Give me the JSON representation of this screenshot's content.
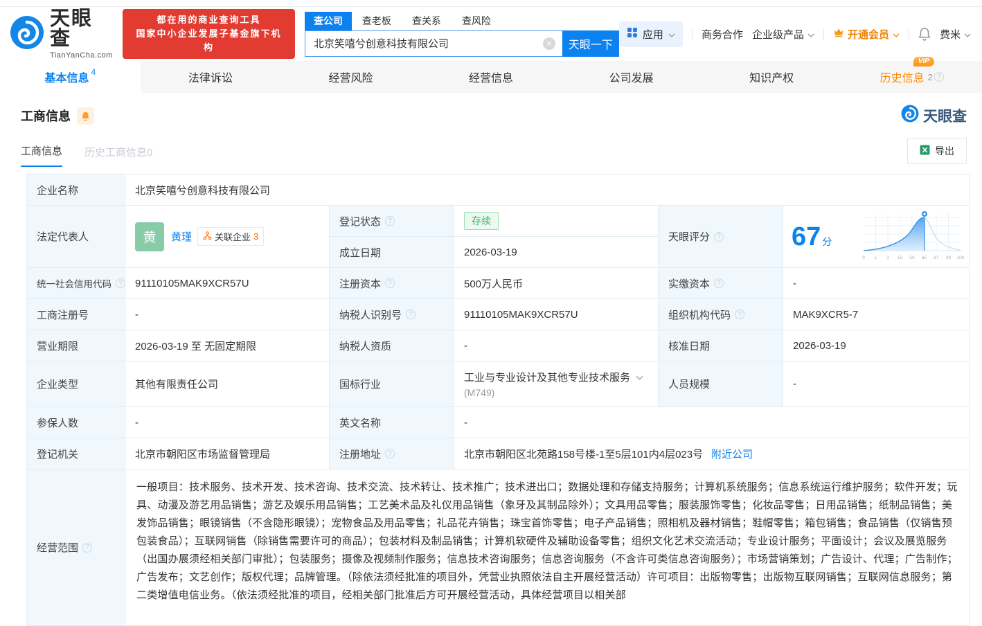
{
  "brand": {
    "name": "天眼查",
    "domain": "TianYanCha.com",
    "slogan1": "都在用的商业查询工具",
    "slogan2": "国家中小企业发展子基金旗下机构"
  },
  "search": {
    "tabs": [
      "查公司",
      "查老板",
      "查关系",
      "查风险"
    ],
    "value": "北京笑嘻兮创意科技有限公司",
    "button": "天眼一下"
  },
  "nav": {
    "apps": "应用",
    "cooperation": "商务合作",
    "enterprise": "企业级产品",
    "vip": "开通会员",
    "user": "费米"
  },
  "tabs": {
    "t0": {
      "label": "基本信息",
      "count": "4"
    },
    "t1": {
      "label": "法律诉讼"
    },
    "t2": {
      "label": "经营风险"
    },
    "t3": {
      "label": "经营信息"
    },
    "t4": {
      "label": "公司发展"
    },
    "t5": {
      "label": "知识产权"
    },
    "t6": {
      "label": "历史信息",
      "count": "2",
      "vip": "VIP"
    }
  },
  "section": {
    "title": "工商信息",
    "watermark": "天眼查",
    "subtab_active": "工商信息",
    "subtab_history": "历史工商信息0",
    "export": "导出"
  },
  "fields": {
    "company_name": {
      "label": "企业名称",
      "value": "北京笑嘻兮创意科技有限公司"
    },
    "legal_rep": {
      "label": "法定代表人",
      "avatar": "黄",
      "name": "黄瑾",
      "related_label": "关联企业",
      "related_count": "3"
    },
    "reg_status": {
      "label": "登记状态",
      "value": "存续"
    },
    "establish_date": {
      "label": "成立日期",
      "value": "2026-03-19"
    },
    "score": {
      "label": "天眼评分",
      "value": "67",
      "unit": "分",
      "ticks": [
        "0",
        "1",
        "3",
        "15",
        "50",
        "85",
        "97",
        "99",
        "100"
      ]
    },
    "credit_code": {
      "label": "统一社会信用代码",
      "value": "91110105MAK9XCR57U"
    },
    "reg_capital": {
      "label": "注册资本",
      "value": "500万人民币"
    },
    "paid_capital": {
      "label": "实缴资本",
      "value": "-"
    },
    "reg_no": {
      "label": "工商注册号",
      "value": "-"
    },
    "taxpayer_no": {
      "label": "纳税人识别号",
      "value": "91110105MAK9XCR57U"
    },
    "org_code": {
      "label": "组织机构代码",
      "value": "MAK9XCR5-7"
    },
    "term": {
      "label": "营业期限",
      "value": "2026-03-19 至 无固定期限"
    },
    "taxpayer_quality": {
      "label": "纳税人资质",
      "value": "-"
    },
    "approved_date": {
      "label": "核准日期",
      "value": "2026-03-19"
    },
    "company_type": {
      "label": "企业类型",
      "value": "其他有限责任公司"
    },
    "industry": {
      "label": "国标行业",
      "value": "工业与专业设计及其他专业技术服务",
      "code": "(M749)"
    },
    "staff": {
      "label": "人员规模",
      "value": "-"
    },
    "insured": {
      "label": "参保人数",
      "value": "-"
    },
    "english_name": {
      "label": "英文名称",
      "value": "-"
    },
    "authority": {
      "label": "登记机关",
      "value": "北京市朝阳区市场监督管理局"
    },
    "address": {
      "label": "注册地址",
      "value": "北京市朝阳区北苑路158号楼-1至5层101内4层023号",
      "nearby": "附近公司"
    },
    "scope": {
      "label": "经营范围",
      "value": "一般项目：技术服务、技术开发、技术咨询、技术交流、技术转让、技术推广；技术进出口；数据处理和存储支持服务；计算机系统服务；信息系统运行维护服务；软件开发；玩具、动漫及游艺用品销售；游艺及娱乐用品销售；工艺美术品及礼仪用品销售（象牙及其制品除外）；文具用品零售；服装服饰零售；化妆品零售；日用品销售；纸制品销售；美发饰品销售；眼镜销售（不含隐形眼镜）；宠物食品及用品零售；礼品花卉销售；珠宝首饰零售；电子产品销售；照相机及器材销售；鞋帽零售；箱包销售；食品销售（仅销售预包装食品）；互联网销售（除销售需要许可的商品）；包装材料及制品销售；计算机软硬件及辅助设备零售；组织文化艺术交流活动；专业设计服务；平面设计；会议及展览服务（出国办展须经相关部门审批）；包装服务；摄像及视频制作服务；信息技术咨询服务；信息咨询服务（不含许可类信息咨询服务）；市场营销策划；广告设计、代理；广告制作；广告发布；文艺创作；版权代理；品牌管理。（除依法须经批准的项目外，凭营业执照依法自主开展经营活动）许可项目：出版物零售；出版物互联网销售；互联网信息服务；第二类增值电信业务。（依法须经批准的项目，经相关部门批准后方可开展经营活动，具体经营项目以相关部"
    }
  },
  "colors": {
    "primary_blue": "#0c82f0",
    "brand_red": "#e23b32",
    "vip_orange": "#f28100",
    "status_green": "#39b362",
    "avatar_green": "#87cba7"
  }
}
